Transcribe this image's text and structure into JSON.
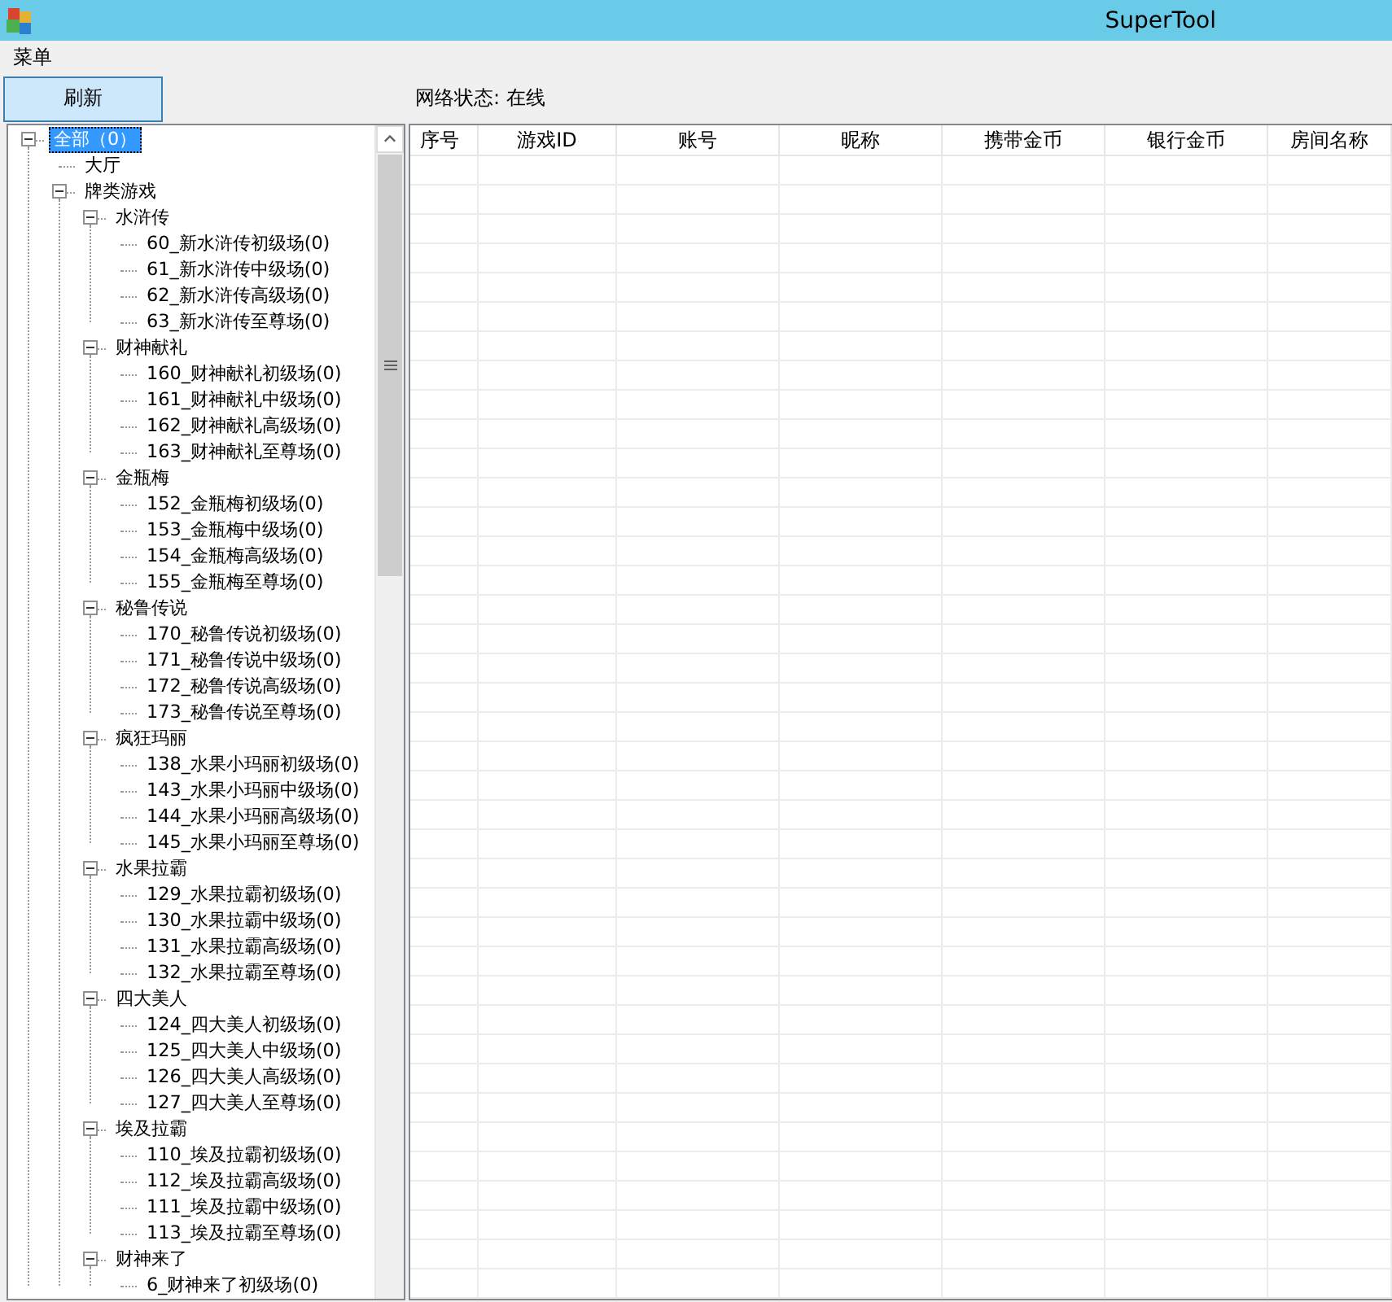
{
  "window": {
    "title": "SuperTool"
  },
  "menu": [
    {
      "label": "菜单"
    }
  ],
  "toolbar": {
    "refresh_button": "刷新",
    "network_status": "网络状态: 在线"
  },
  "tree": [
    {
      "label": "全部（0）",
      "selected": true,
      "expanded": true,
      "children": [
        {
          "label": "大厅",
          "selected": false
        },
        {
          "label": "牌类游戏",
          "selected": false,
          "expanded": true,
          "children": [
            {
              "label": "水浒传",
              "selected": false,
              "expanded": true,
              "children": [
                {
                  "label": "60_新水浒传初级场(0)",
                  "selected": false
                },
                {
                  "label": "61_新水浒传中级场(0)",
                  "selected": false
                },
                {
                  "label": "62_新水浒传高级场(0)",
                  "selected": false
                },
                {
                  "label": "63_新水浒传至尊场(0)",
                  "selected": false
                }
              ]
            },
            {
              "label": "财神献礼",
              "selected": false,
              "expanded": true,
              "children": [
                {
                  "label": "160_财神献礼初级场(0)",
                  "selected": false
                },
                {
                  "label": "161_财神献礼中级场(0)",
                  "selected": false
                },
                {
                  "label": "162_财神献礼高级场(0)",
                  "selected": false
                },
                {
                  "label": "163_财神献礼至尊场(0)",
                  "selected": false
                }
              ]
            },
            {
              "label": "金瓶梅",
              "selected": false,
              "expanded": true,
              "children": [
                {
                  "label": "152_金瓶梅初级场(0)",
                  "selected": false
                },
                {
                  "label": "153_金瓶梅中级场(0)",
                  "selected": false
                },
                {
                  "label": "154_金瓶梅高级场(0)",
                  "selected": false
                },
                {
                  "label": "155_金瓶梅至尊场(0)",
                  "selected": false
                }
              ]
            },
            {
              "label": "秘鲁传说",
              "selected": false,
              "expanded": true,
              "children": [
                {
                  "label": "170_秘鲁传说初级场(0)",
                  "selected": false
                },
                {
                  "label": "171_秘鲁传说中级场(0)",
                  "selected": false
                },
                {
                  "label": "172_秘鲁传说高级场(0)",
                  "selected": false
                },
                {
                  "label": "173_秘鲁传说至尊场(0)",
                  "selected": false
                }
              ]
            },
            {
              "label": "疯狂玛丽",
              "selected": false,
              "expanded": true,
              "children": [
                {
                  "label": "138_水果小玛丽初级场(0)",
                  "selected": false
                },
                {
                  "label": "143_水果小玛丽中级场(0)",
                  "selected": false
                },
                {
                  "label": "144_水果小玛丽高级场(0)",
                  "selected": false
                },
                {
                  "label": "145_水果小玛丽至尊场(0)",
                  "selected": false
                }
              ]
            },
            {
              "label": "水果拉霸",
              "selected": false,
              "expanded": true,
              "children": [
                {
                  "label": "129_水果拉霸初级场(0)",
                  "selected": false
                },
                {
                  "label": "130_水果拉霸中级场(0)",
                  "selected": false
                },
                {
                  "label": "131_水果拉霸高级场(0)",
                  "selected": false
                },
                {
                  "label": "132_水果拉霸至尊场(0)",
                  "selected": false
                }
              ]
            },
            {
              "label": "四大美人",
              "selected": false,
              "expanded": true,
              "children": [
                {
                  "label": "124_四大美人初级场(0)",
                  "selected": false
                },
                {
                  "label": "125_四大美人中级场(0)",
                  "selected": false
                },
                {
                  "label": "126_四大美人高级场(0)",
                  "selected": false
                },
                {
                  "label": "127_四大美人至尊场(0)",
                  "selected": false
                }
              ]
            },
            {
              "label": "埃及拉霸",
              "selected": false,
              "expanded": true,
              "children": [
                {
                  "label": "110_埃及拉霸初级场(0)",
                  "selected": false
                },
                {
                  "label": "112_埃及拉霸高级场(0)",
                  "selected": false
                },
                {
                  "label": "111_埃及拉霸中级场(0)",
                  "selected": false
                },
                {
                  "label": "113_埃及拉霸至尊场(0)",
                  "selected": false
                }
              ]
            },
            {
              "label": "财神来了",
              "selected": false,
              "expanded": true,
              "children": [
                {
                  "label": "6_财神来了初级场(0)",
                  "selected": false
                }
              ]
            }
          ]
        }
      ]
    }
  ],
  "table": {
    "columns": [
      "序号",
      "游戏ID",
      "账号",
      "昵称",
      "携带金币",
      "银行金币",
      "房间名称"
    ]
  }
}
